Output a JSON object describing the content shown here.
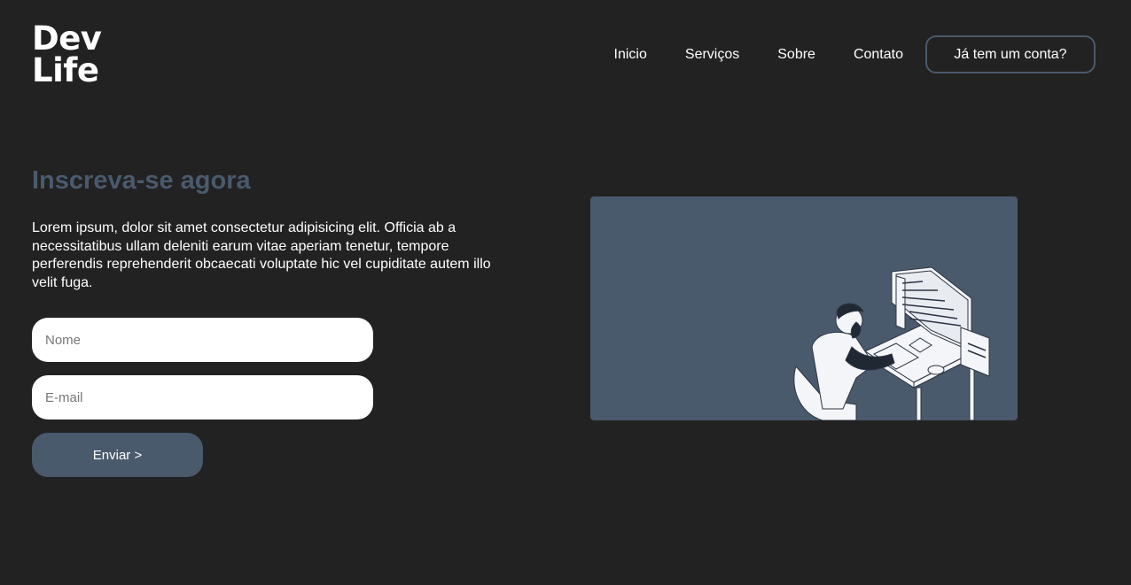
{
  "brand": {
    "line1": "Dev",
    "line2": "Life"
  },
  "nav": {
    "items": [
      "Inicio",
      "Serviços",
      "Sobre",
      "Contato"
    ],
    "login_label": "Já tem um conta?"
  },
  "hero": {
    "heading": "Inscreva-se agora",
    "description": "Lorem ipsum, dolor sit amet consectetur adipisicing elit. Officia ab a necessitatibus ullam deleniti earum vitae aperiam tenetur, tempore perferendis reprehenderit obcaecati voluptate hic vel cupiditate autem illo velit fuga."
  },
  "form": {
    "name_placeholder": "Nome",
    "email_placeholder": "E-mail",
    "submit_label": "Enviar >"
  },
  "illustration": {
    "icon": "developer-at-computer-illustration"
  },
  "colors": {
    "background": "#222222",
    "accent": "#4a5a6d",
    "text": "#ffffff"
  }
}
